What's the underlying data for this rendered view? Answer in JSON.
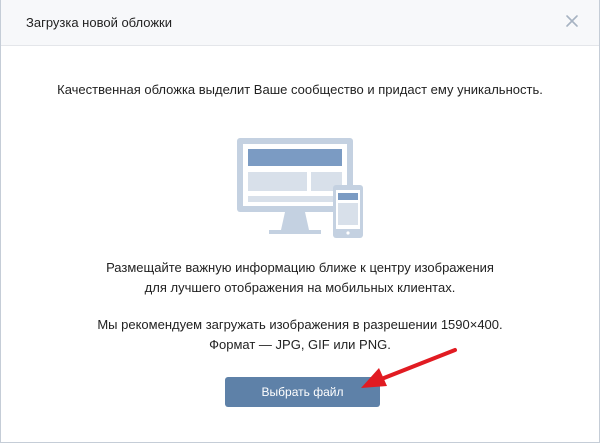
{
  "modal": {
    "title": "Загрузка новой обложки",
    "tagline": "Качественная обложка выделит Ваше сообщество и придаст ему уникальность.",
    "tips": [
      "Размещайте важную информацию ближе к центру изображения",
      "для лучшего отображения на мобильных клиентах."
    ],
    "recommend": [
      "Мы рекомендуем загружать изображения в разрешении 1590×400.",
      "Формат — JPG, GIF или PNG."
    ],
    "button_label": "Выбрать файл"
  },
  "icons": {
    "close": "close-icon",
    "illustration": "desktop-mobile-illustration",
    "annotation": "red-arrow"
  },
  "colors": {
    "button": "#5e81a8",
    "illustration": "#8ca6c6",
    "arrow": "#e11b22"
  }
}
